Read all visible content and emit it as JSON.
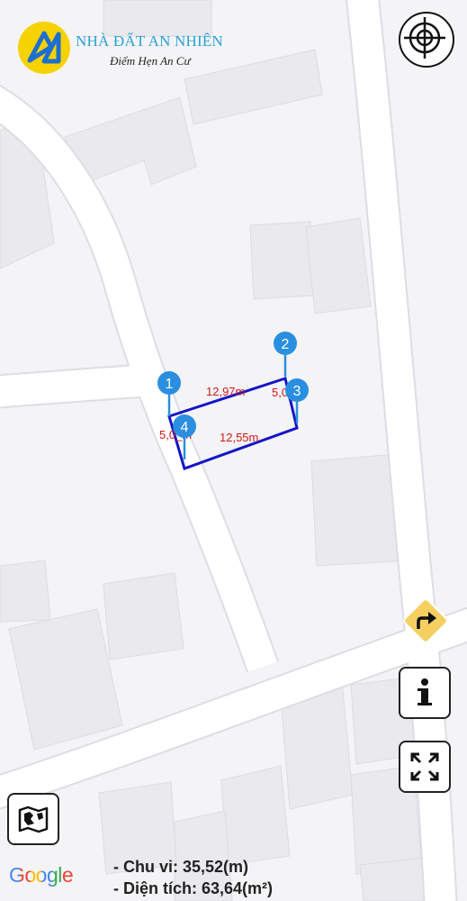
{
  "brand": {
    "name": "NHÀ ĐẤT AN NHIÊN",
    "slogan": "Điểm Hẹn An Cư"
  },
  "markers": [
    {
      "label": "1"
    },
    {
      "label": "2"
    },
    {
      "label": "3"
    },
    {
      "label": "4"
    }
  ],
  "edges": [
    {
      "label": "12,97m"
    },
    {
      "label": "5,0_m"
    },
    {
      "label": "12,55m"
    },
    {
      "label": "5,0_m"
    }
  ],
  "attribution": "Google",
  "stats": {
    "perimeter": "- Chu vi: 35,52(m)",
    "area": "- Diện tích: 63,64(m²)"
  },
  "colors": {
    "plot_outline": "#1515c8",
    "marker": "#2a8fe0",
    "edge_label": "#d01818",
    "direction_button": "#f5d060"
  },
  "icons": [
    "crosshair-icon",
    "turn-right-icon",
    "info-icon",
    "fullscreen-icon",
    "map-layers-icon"
  ]
}
